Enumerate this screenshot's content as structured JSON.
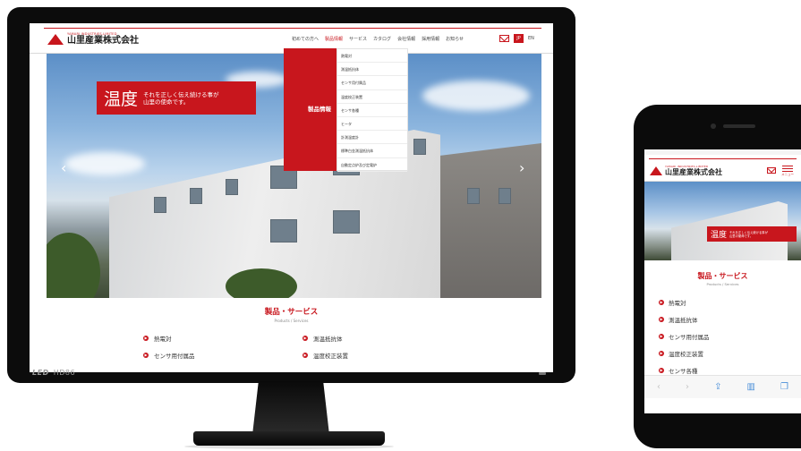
{
  "desktop": {
    "chin_brand": "LED",
    "chin_model": "HD86",
    "logo_en": "YAMARI INDUSTRIES,LIMITED",
    "logo_ja": "山里産業株式会社",
    "nav": [
      "初めての方へ",
      "製品情報",
      "サービス",
      "カタログ",
      "会社情報",
      "採用情報",
      "お知らせ"
    ],
    "lang_jp": "JP",
    "lang_en": "EN",
    "hero_big": "温度",
    "hero_small_1": "それを正しく伝え続ける事が",
    "hero_small_2": "山里の使命です。",
    "prev_arrow": "‹",
    "next_arrow": "›",
    "dropdown_title": "製品情報",
    "dropdown_items": [
      "熱電対",
      "測温抵抗体",
      "センサ用付属品",
      "温度校正装置",
      "センサ各種",
      "ヒータ",
      "計測温度計",
      "標準白金測温抵抗体",
      "自動定点炉及び定電炉"
    ],
    "section_title": "製品・サービス",
    "section_sub": "Products / Services",
    "products": [
      "熱電対",
      "測温抵抗体",
      "センサ用付属品",
      "温度校正装置"
    ]
  },
  "mobile": {
    "logo_en": "YAMARI INDUSTRIES,LIMITED",
    "logo_ja": "山里産業株式会社",
    "menu_label": "メニュー",
    "hero_big": "温度",
    "hero_small_1": "それを正しく伝え続ける事が",
    "hero_small_2": "山里の使命です。",
    "section_title": "製品・サービス",
    "section_sub": "Products / Services",
    "products": [
      "熱電対",
      "測温抵抗体",
      "センサ用付属品",
      "温度校正装置",
      "センサ各種"
    ],
    "toolbar": {
      "back": "‹",
      "forward": "›",
      "share": "⇪",
      "bookmarks": "▥",
      "tabs": "❐"
    }
  },
  "colors": {
    "brand_red": "#c8161d",
    "link_blue": "#4a8fd8"
  }
}
